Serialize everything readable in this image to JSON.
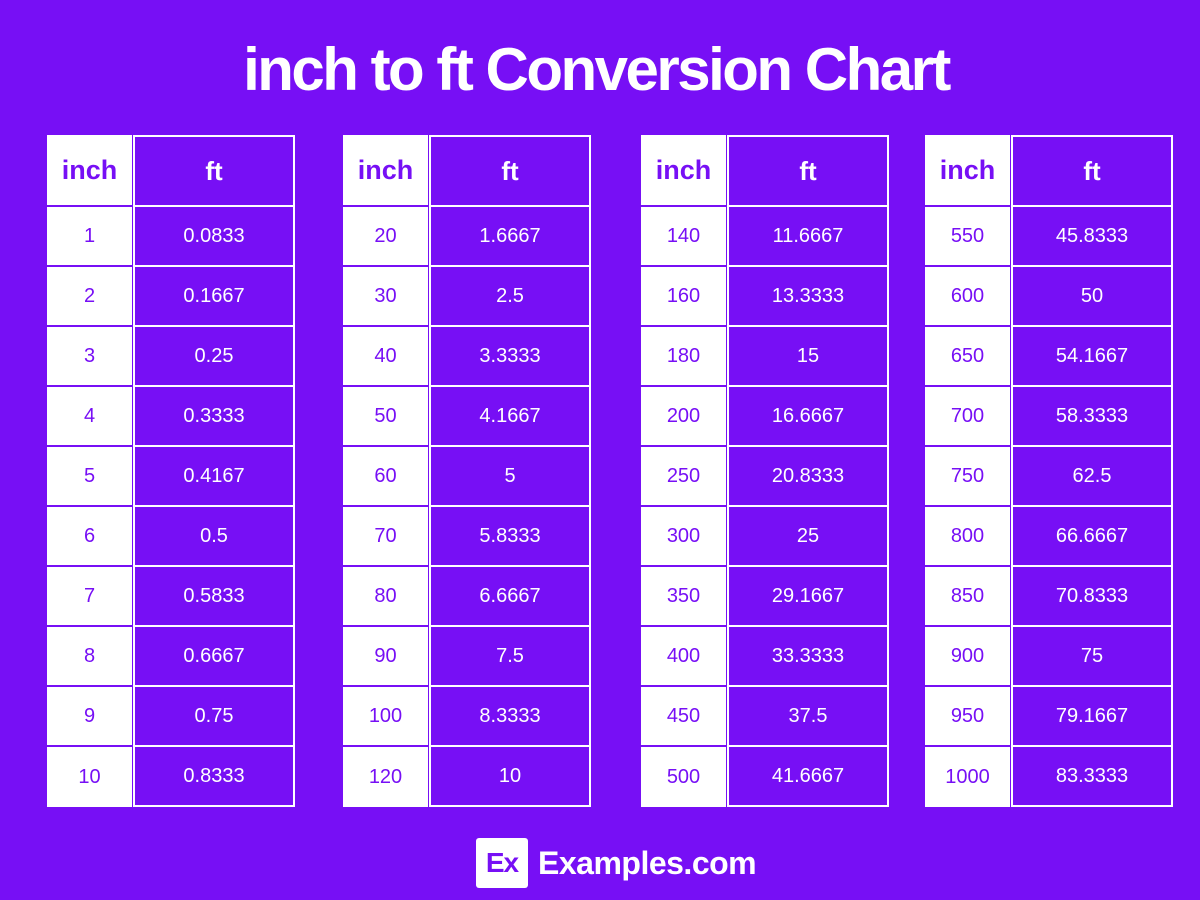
{
  "title": "inch to ft Conversion Chart",
  "headers": {
    "inch": "inch",
    "ft": "ft"
  },
  "tables": [
    {
      "rows": [
        [
          "1",
          "0.0833"
        ],
        [
          "2",
          "0.1667"
        ],
        [
          "3",
          "0.25"
        ],
        [
          "4",
          "0.3333"
        ],
        [
          "5",
          "0.4167"
        ],
        [
          "6",
          "0.5"
        ],
        [
          "7",
          "0.5833"
        ],
        [
          "8",
          "0.6667"
        ],
        [
          "9",
          "0.75"
        ],
        [
          "10",
          "0.8333"
        ]
      ]
    },
    {
      "rows": [
        [
          "20",
          "1.6667"
        ],
        [
          "30",
          "2.5"
        ],
        [
          "40",
          "3.3333"
        ],
        [
          "50",
          "4.1667"
        ],
        [
          "60",
          "5"
        ],
        [
          "70",
          "5.8333"
        ],
        [
          "80",
          "6.6667"
        ],
        [
          "90",
          "7.5"
        ],
        [
          "100",
          "8.3333"
        ],
        [
          "120",
          "10"
        ]
      ]
    },
    {
      "rows": [
        [
          "140",
          "11.6667"
        ],
        [
          "160",
          "13.3333"
        ],
        [
          "180",
          "15"
        ],
        [
          "200",
          "16.6667"
        ],
        [
          "250",
          "20.8333"
        ],
        [
          "300",
          "25"
        ],
        [
          "350",
          "29.1667"
        ],
        [
          "400",
          "33.3333"
        ],
        [
          "450",
          "37.5"
        ],
        [
          "500",
          "41.6667"
        ]
      ]
    },
    {
      "rows": [
        [
          "550",
          "45.8333"
        ],
        [
          "600",
          "50"
        ],
        [
          "650",
          "54.1667"
        ],
        [
          "700",
          "58.3333"
        ],
        [
          "750",
          "62.5"
        ],
        [
          "800",
          "66.6667"
        ],
        [
          "850",
          "70.8333"
        ],
        [
          "900",
          "75"
        ],
        [
          "950",
          "79.1667"
        ],
        [
          "1000",
          "83.3333"
        ]
      ]
    }
  ],
  "logo": {
    "mark": "Ex",
    "text": "Examples.com"
  },
  "colors": {
    "background": "#770ff5",
    "cell_light": "#ffffff"
  }
}
